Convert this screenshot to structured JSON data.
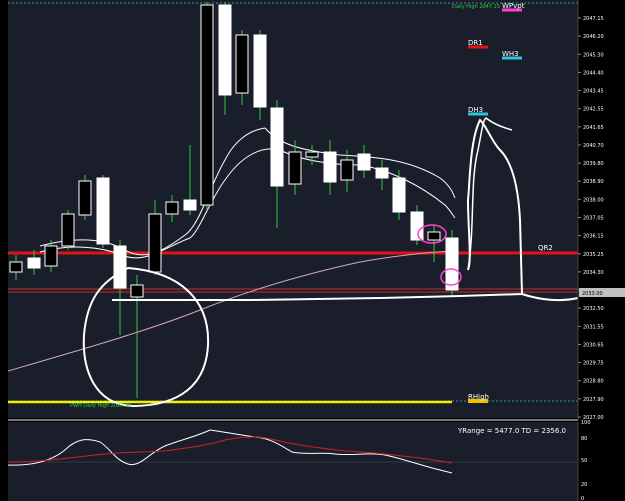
{
  "colors": {
    "background": "#1a1e2a",
    "frame": "#000000",
    "bull_fill": "#ffffff",
    "bear_fill": "#000000",
    "candle_edge": "#ffffff",
    "wick": "#2ecc40",
    "ma_line": "#ffffff",
    "trend_line": "#d8a8b8",
    "red_level": "#e01414",
    "yellow_level": "#f0f000",
    "teal_dashed": "#2a9d8f",
    "pink_circle": "#ff44cc",
    "osc_line_1": "#ffffff",
    "osc_line_2": "#cc2222",
    "axis_text": "#ffffff"
  },
  "price_axis": {
    "ticks": [
      "2047.15",
      "2046.20",
      "2045.30",
      "2044.40",
      "2043.45",
      "2042.55",
      "2041.65",
      "2040.70",
      "2039.80",
      "2038.90",
      "2038.00",
      "2037.05",
      "2036.15",
      "2035.25",
      "2034.30",
      "2033.40",
      "2032.50",
      "2031.55",
      "2030.65",
      "2029.75",
      "2028.80",
      "2027.90",
      "2027.00"
    ],
    "current_price": "2033.00"
  },
  "osc_axis": {
    "ticks": [
      "100",
      "80",
      "50",
      "20",
      "0"
    ]
  },
  "levels": [
    {
      "name": "DR1",
      "color": "#e01414"
    },
    {
      "name": "WH3",
      "color": "#2ec4d6"
    },
    {
      "name": "DH3",
      "color": "#2ec4d6"
    },
    {
      "name": "WPvpt",
      "color": "#ff44cc"
    },
    {
      "name": "QR2",
      "color": "#e01414"
    },
    {
      "name": "RHigh",
      "color": "#f0c000"
    }
  ],
  "annotations": {
    "top_note": "Daily High 2047.15",
    "bottom_note": "PWH Daily High 2027.90",
    "osc_readout": "YRange = 5477.0    TD = 2356.0"
  }
}
